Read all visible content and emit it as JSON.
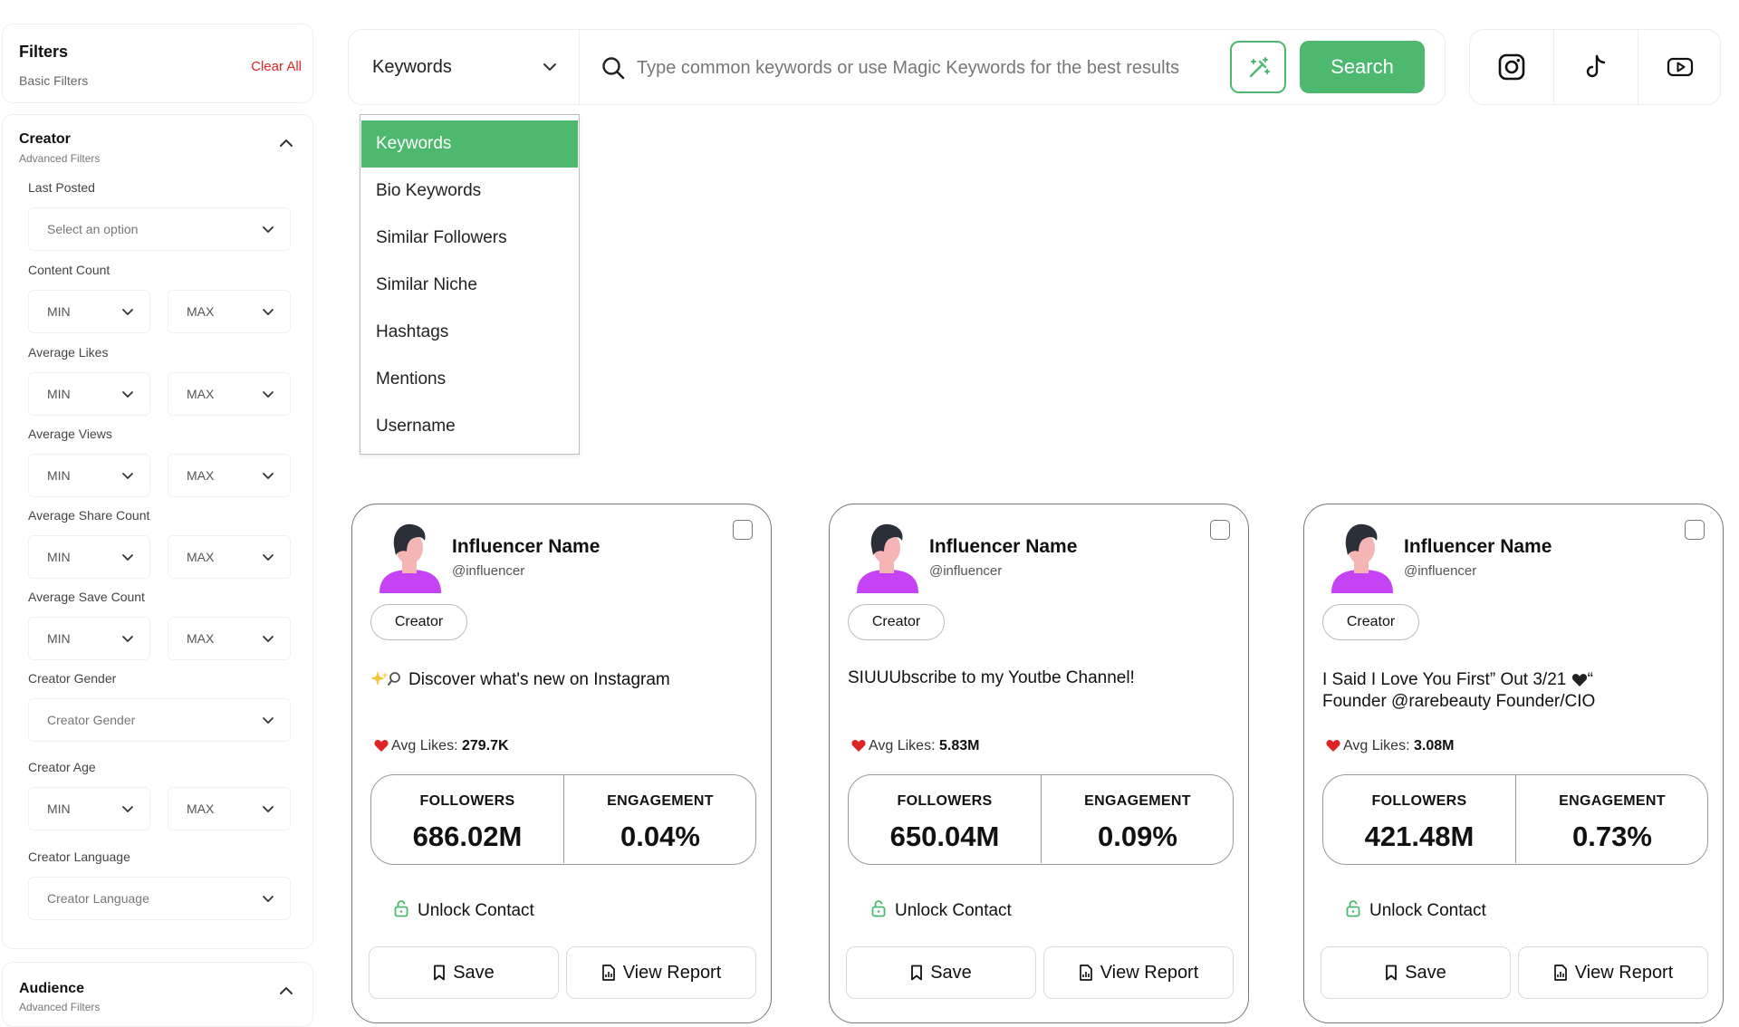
{
  "colors": {
    "accent": "#4cb96f",
    "danger": "#e02424",
    "avatar_shirt": "#c542f5",
    "avatar_hair": "#2b2f3a",
    "avatar_skin": "#f5b5b5"
  },
  "filters": {
    "title": "Filters",
    "subtitle": "Basic Filters",
    "clear_all": "Clear All"
  },
  "creator_section": {
    "title": "Creator",
    "subtitle": "Advanced Filters",
    "last_posted": {
      "label": "Last Posted",
      "placeholder": "Select an option"
    },
    "content_count": {
      "label": "Content Count",
      "min": "MIN",
      "max": "MAX"
    },
    "average_likes": {
      "label": "Average Likes",
      "min": "MIN",
      "max": "MAX"
    },
    "average_views": {
      "label": "Average Views",
      "min": "MIN",
      "max": "MAX"
    },
    "average_share_count": {
      "label": "Average Share Count",
      "min": "MIN",
      "max": "MAX"
    },
    "average_save_count": {
      "label": "Average Save Count",
      "min": "MIN",
      "max": "MAX"
    },
    "creator_gender": {
      "label": "Creator Gender",
      "placeholder": "Creator Gender"
    },
    "creator_age": {
      "label": "Creator Age",
      "min": "MIN",
      "max": "MAX"
    },
    "creator_language": {
      "label": "Creator Language",
      "placeholder": "Creator Language"
    }
  },
  "audience_section": {
    "title": "Audience",
    "subtitle": "Advanced Filters"
  },
  "search": {
    "type_selected": "Keywords",
    "placeholder": "Type common keywords or use Magic Keywords for the best results",
    "value": "",
    "button_label": "Search",
    "magic_icon": "magic-wand-icon"
  },
  "platforms": [
    {
      "name": "instagram",
      "icon": "instagram-icon"
    },
    {
      "name": "tiktok",
      "icon": "tiktok-icon"
    },
    {
      "name": "youtube",
      "icon": "youtube-icon"
    }
  ],
  "dropdown": {
    "options": [
      "Keywords",
      "Bio Keywords",
      "Similar Followers",
      "Similar Niche",
      "Hashtags",
      "Mentions",
      "Username"
    ],
    "selected_index": 0
  },
  "cards": [
    {
      "name": "Influencer Name",
      "handle": "@influencer",
      "tag": "Creator",
      "bio_line1": "Discover what's new on Instagram",
      "bio_line2": "",
      "bio_icon": "sparkles-icon",
      "avg_likes_label": "Avg Likes:",
      "avg_likes": "279.7K",
      "followers_label": "FOLLOWERS",
      "followers": "686.02M",
      "engagement_label": "ENGAGEMENT",
      "engagement": "0.04%",
      "unlock": "Unlock Contact",
      "save": "Save",
      "report": "View Report"
    },
    {
      "name": "Influencer Name",
      "handle": "@influencer",
      "tag": "Creator",
      "bio_line1": "SIUUUbscribe to my Youtbe Channel!",
      "bio_line2": "",
      "avg_likes_label": "Avg Likes:",
      "avg_likes": "5.83M",
      "followers_label": "FOLLOWERS",
      "followers": "650.04M",
      "engagement_label": "ENGAGEMENT",
      "engagement": "0.09%",
      "unlock": "Unlock Contact",
      "save": "Save",
      "report": "View Report"
    },
    {
      "name": "Influencer Name",
      "handle": "@influencer",
      "tag": "Creator",
      "bio_line1": "I Said I Love You First” Out 3/21",
      "bio_line1_suffix": "“",
      "bio_line1_icon": "black-heart-icon",
      "bio_line2": "Founder @rarebeauty Founder/CIO",
      "avg_likes_label": "Avg Likes:",
      "avg_likes": "3.08M",
      "followers_label": "FOLLOWERS",
      "followers": "421.48M",
      "engagement_label": "ENGAGEMENT",
      "engagement": "0.73%",
      "unlock": "Unlock Contact",
      "save": "Save",
      "report": "View Report"
    }
  ]
}
